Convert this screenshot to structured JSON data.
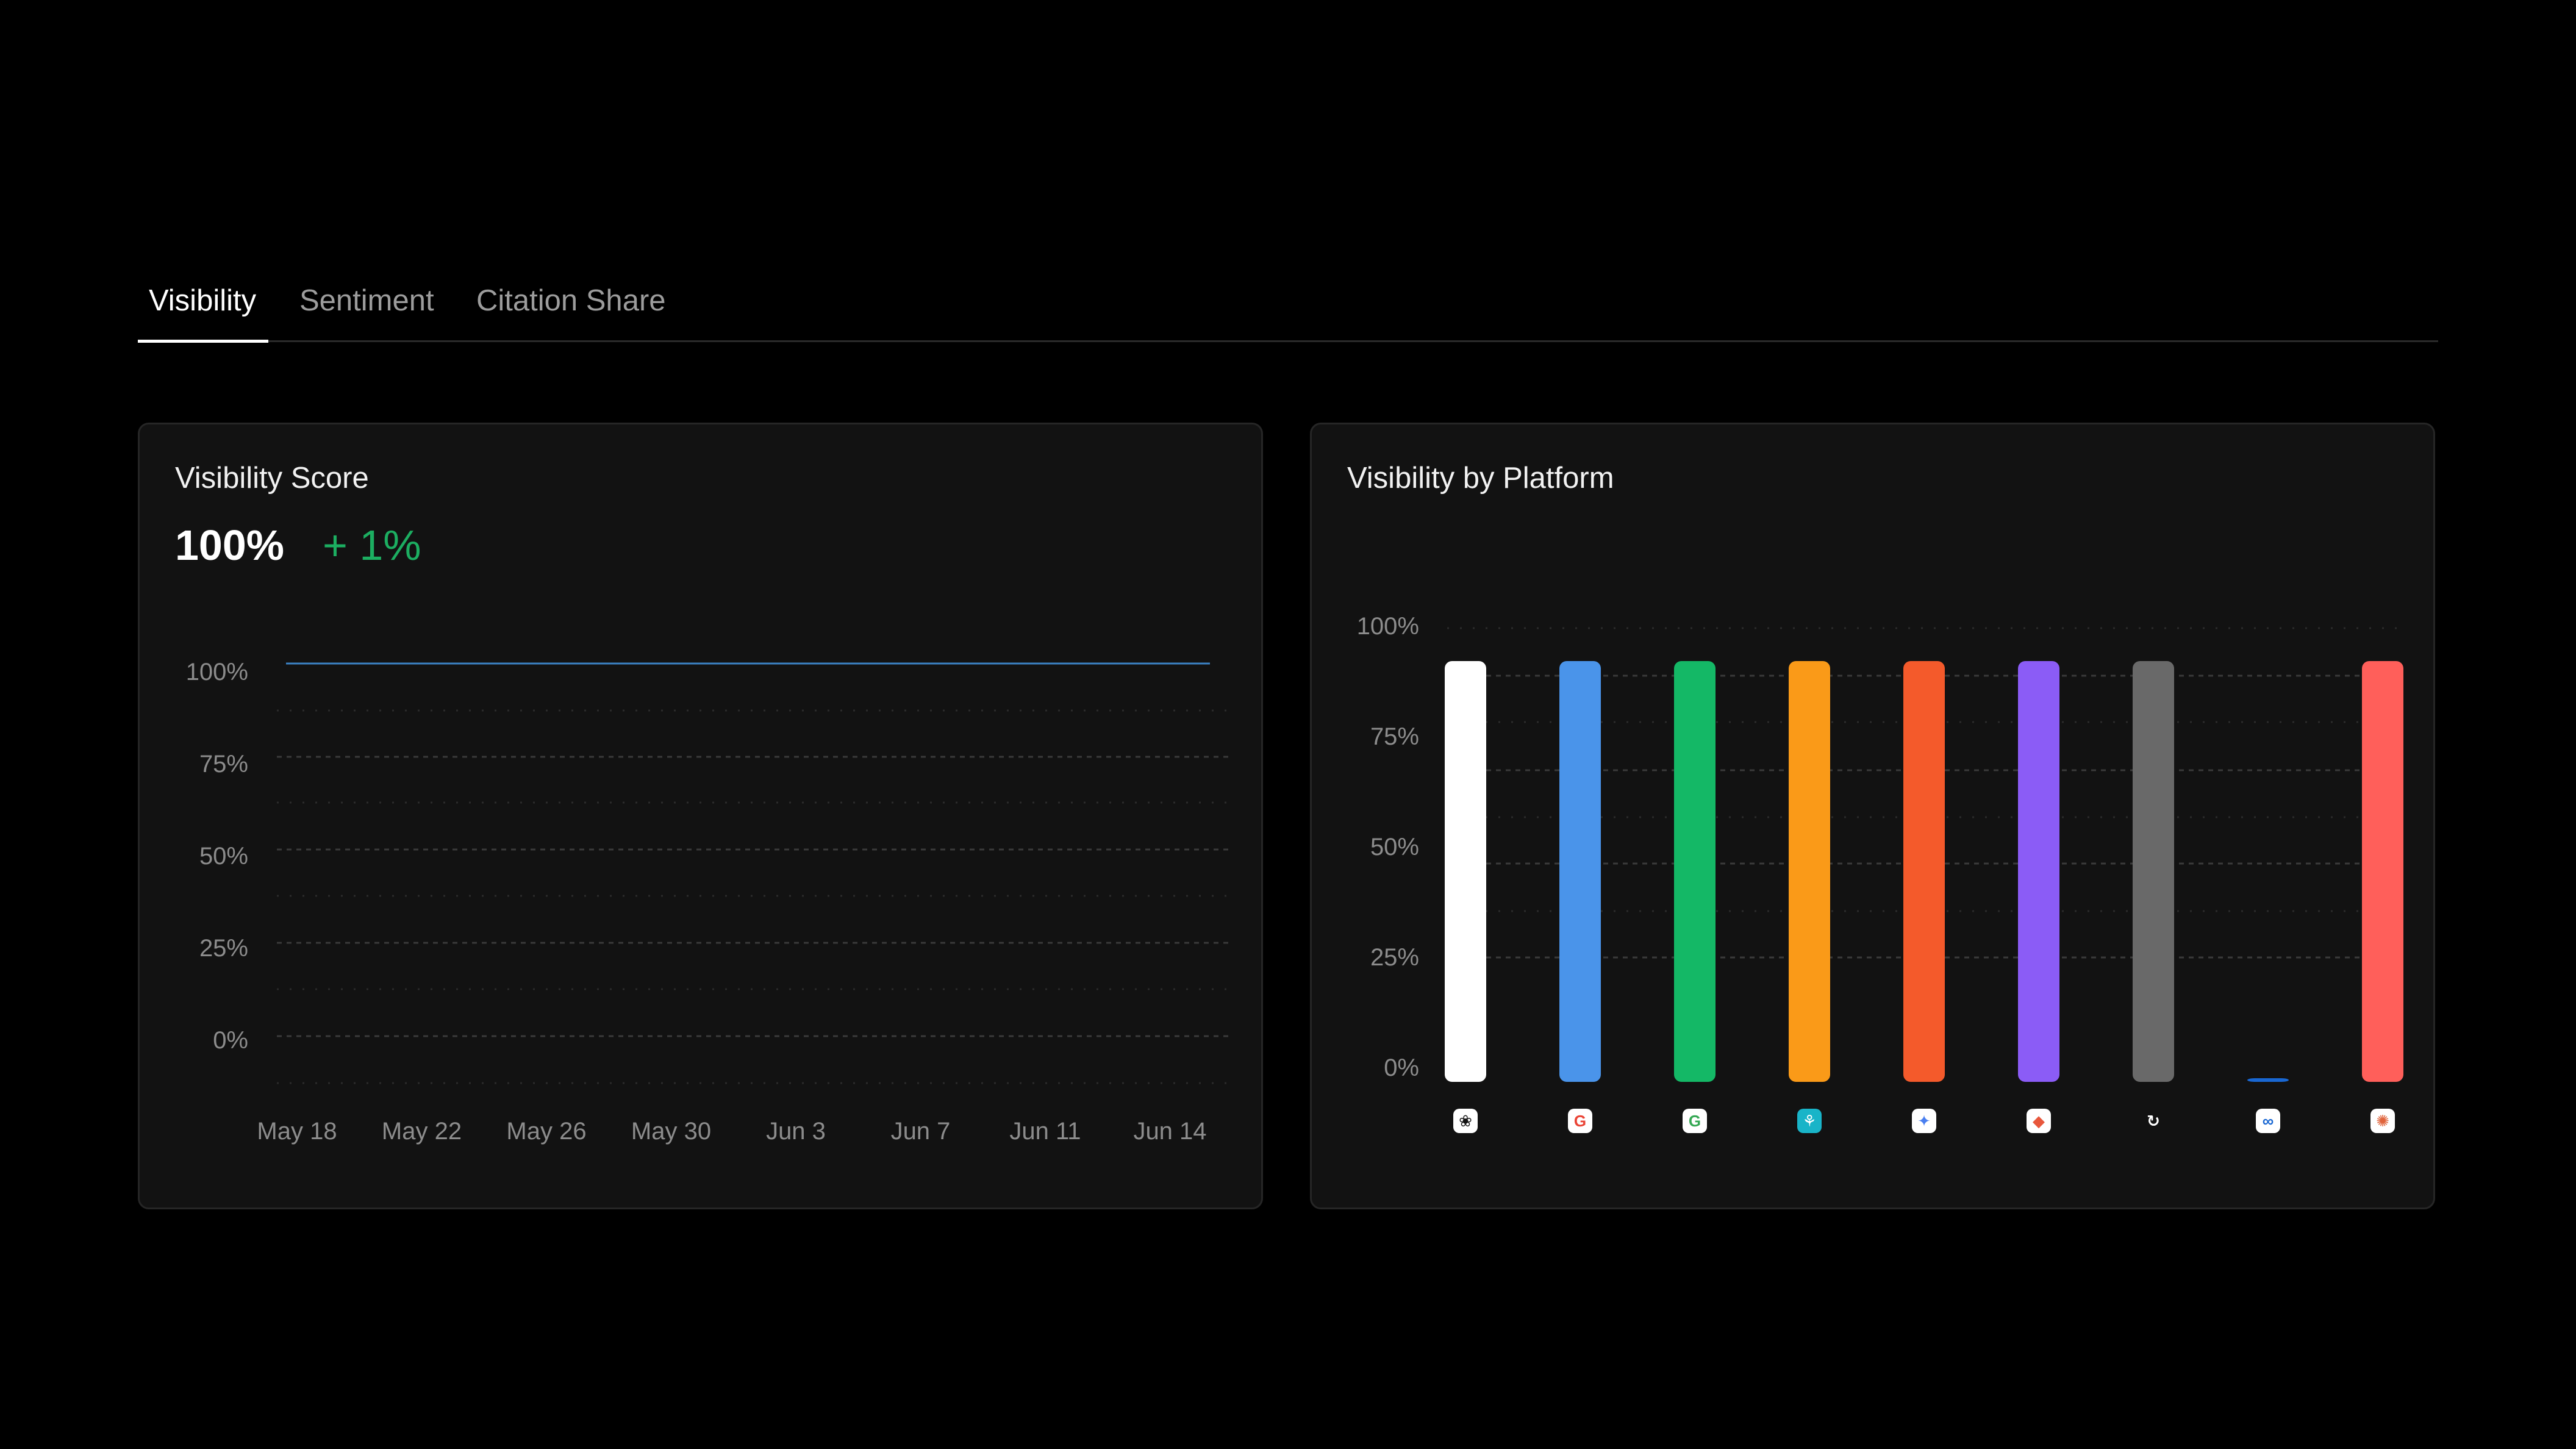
{
  "tabs": [
    {
      "label": "Visibility",
      "active": true
    },
    {
      "label": "Sentiment",
      "active": false
    },
    {
      "label": "Citation Share",
      "active": false
    }
  ],
  "score_card": {
    "title": "Visibility Score",
    "value": "100%",
    "delta": "+ 1%"
  },
  "platform_card": {
    "title": "Visibility by Platform"
  },
  "colors": {
    "background": "#000000",
    "card": "#121212",
    "delta_positive": "#1cae61",
    "line": "#3b82c4"
  },
  "chart_data": [
    {
      "type": "line",
      "title": "Visibility Score",
      "x_tick_labels": [
        "May 18",
        "May 22",
        "May 26",
        "May 30",
        "Jun 3",
        "Jun 7",
        "Jun 11",
        "Jun 14"
      ],
      "y_tick_labels": [
        "100%",
        "75%",
        "50%",
        "25%",
        "0%"
      ],
      "ylim": [
        0,
        100
      ],
      "series": [
        {
          "values": [
            100,
            100,
            100,
            100,
            100,
            100,
            100,
            100
          ],
          "color": "#3b82c4"
        }
      ],
      "grid": true
    },
    {
      "type": "bar",
      "title": "Visibility by Platform",
      "categories": [
        "chatgpt-icon",
        "google-icon",
        "google-ai-icon",
        "deepseek-icon",
        "gemini-icon",
        "copilot-icon",
        "perplexity-icon",
        "meta-ai-icon",
        "claude-icon"
      ],
      "values": [
        100,
        100,
        100,
        100,
        100,
        100,
        100,
        0,
        100
      ],
      "bar_colors": [
        "#ffffff",
        "#4a94ea",
        "#14b866",
        "#fa9a18",
        "#f45a2b",
        "#8b5cf6",
        "#696969",
        "#1967d2",
        "#ff5f5a"
      ],
      "y_tick_labels": [
        "100%",
        "75%",
        "50%",
        "25%",
        "0%"
      ],
      "ylim": [
        0,
        100
      ],
      "grid": true
    }
  ]
}
